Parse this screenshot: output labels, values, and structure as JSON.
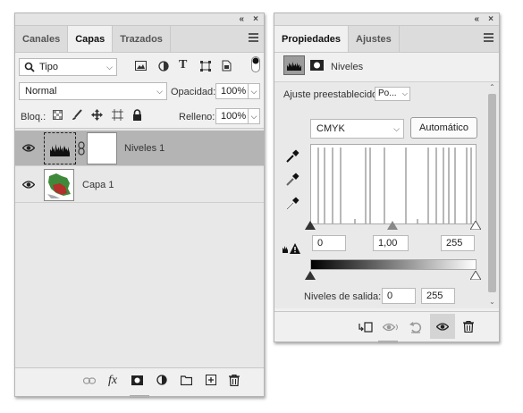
{
  "layers_panel": {
    "tabs": [
      "Canales",
      "Capas",
      "Trazados"
    ],
    "filter": {
      "selected": "Tipo"
    },
    "blend_mode": "Normal",
    "opacity_label": "Opacidad:",
    "opacity_value": "100%",
    "lock_label": "Bloq.:",
    "fill_label": "Relleno:",
    "fill_value": "100%",
    "layers": [
      {
        "name": "Niveles 1",
        "selected": true,
        "visible": true
      },
      {
        "name": "Capa 1",
        "selected": false,
        "visible": true
      }
    ],
    "bottom_icons": [
      "link-icon",
      "fx-icon",
      "mask-icon",
      "adjustment-icon",
      "folder-icon",
      "new-layer-icon",
      "trash-icon"
    ],
    "fx_label": "fx"
  },
  "properties_panel": {
    "tabs": [
      "Propiedades",
      "Ajustes"
    ],
    "header_title": "Niveles",
    "preset_label": "Ajuste preestablecido:",
    "preset_value": "Po...",
    "channel": "CMYK",
    "auto_button": "Automático",
    "input_black": "0",
    "input_gamma": "1,00",
    "input_white": "255",
    "output_label": "Niveles de salida:",
    "output_black": "0",
    "output_white": "255"
  },
  "colors": {
    "panel_bg": "#f0f0f0",
    "selected_row": "#b4b4b4",
    "tab_bar": "#dcdcdc"
  }
}
